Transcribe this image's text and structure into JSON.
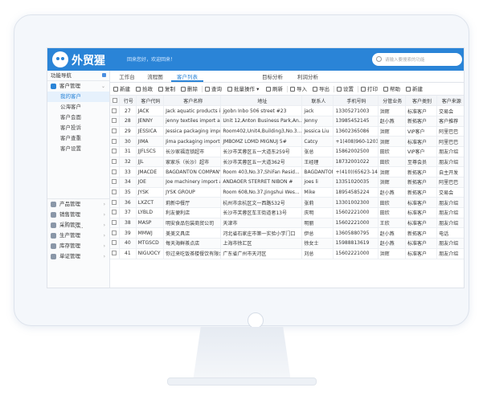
{
  "header": {
    "logo_text": "外贸猩",
    "welcome": "回来您好，欢迎回来！",
    "search_placeholder": "请输入要搜索的功能"
  },
  "sidebar": {
    "title": "功能导航",
    "group_open": "客户管理",
    "subitems": [
      "我的客户",
      "公海客户",
      "客户会面",
      "客户投诉",
      "客户查重",
      "客户设置"
    ],
    "groups": [
      "产品管理",
      "销售管理",
      "采购管理",
      "生产管理",
      "库存管理",
      "单证管理"
    ]
  },
  "tabs": [
    "工作台",
    "流程图",
    "客户列表",
    "目标分析",
    "利润分析"
  ],
  "toolbar": [
    "新建",
    "拾政",
    "复制",
    "删除",
    "查询",
    "批量操作",
    "刷新",
    "导入",
    "导出",
    "设置",
    "打印",
    "帮助",
    "新建"
  ],
  "table": {
    "headers": [
      "",
      "行号",
      "客户代码",
      "客户名称",
      "地址",
      "联系人",
      "手机号码",
      "分管业务",
      "客户类别",
      "客户来源",
      "客户"
    ],
    "rows": [
      [
        "27",
        "JACK",
        "Jack aquatic products im...",
        "jgobn  Inbo  506 street #23",
        "jack",
        "13305271003",
        "洪辉",
        "标准客户",
        "交易会",
        "B"
      ],
      [
        "28",
        "JENNY",
        "jenny textiles import and e...",
        "Unit 12,Anton Business Park,An...",
        "Jenny",
        "13985452145",
        "赵小燕",
        "新拓客户",
        "客户推荐",
        "C"
      ],
      [
        "29",
        "JESSICA",
        "Jessica packaging import...",
        "Room402,Unit4,Building3,No.3...",
        "Jessica Liu",
        "13602365086",
        "洪辉",
        "VIP客户",
        "阿里巴巴",
        "B"
      ],
      [
        "30",
        "JIMA",
        "Jima packaging import an...",
        "JMBOMZ  LOMD  MIGNUJ 5#",
        "Catcy",
        "+1(408)960-1203",
        "洪辉",
        "标准客户",
        "阿里巴巴",
        "C"
      ],
      [
        "31",
        "JJFLSCS",
        "长沙家福连锁超市",
        "长沙市芙蓉区五一大道东259号",
        "张总",
        "15862002500",
        "田欣",
        "VIP客户",
        "朋友介绍",
        "A"
      ],
      [
        "32",
        "JJL",
        "家家乐（长沙）超市",
        "长沙市芙蓉区五一大道362号",
        "王经理",
        "18732001022",
        "田欣",
        "至尊会员",
        "朋友介绍",
        "A"
      ],
      [
        "33",
        "JMACDE",
        "BAGDANTON  COMPANY",
        "Room 403,No.37,ShiFan Resid...",
        "BAGDANTON",
        "+(410)(65623-14711",
        "洪辉",
        "新拓客户",
        "自主开发",
        "A"
      ],
      [
        "34",
        "JOE",
        "Joe machinery import and...",
        "ANDAOER  STERRET NIBON  #",
        "joes li",
        "13351020035",
        "洪辉",
        "新拓客户",
        "阿里巴巴",
        "A"
      ],
      [
        "35",
        "JYSK",
        "JYSK GROUP",
        "Room 608,No.37,Jingshui Wes...",
        "Mike",
        "18954585224",
        "赵小燕",
        "新拓客户",
        "交易会",
        "A"
      ],
      [
        "36",
        "LXZCT",
        "莉新中餐厅",
        "杭州市余杭区文一西路532号",
        "张莉",
        "13301002300",
        "田欣",
        "标准客户",
        "朋友介绍",
        "B"
      ],
      [
        "37",
        "LYBLD",
        "利友便利店",
        "长沙市芙蓉区车王街道者13号",
        "庆明",
        "15602221000",
        "田欣",
        "标准客户",
        "朋友介绍",
        "A"
      ],
      [
        "38",
        "MASP",
        "明安食品包装商贸公司",
        "天津市",
        "明丽",
        "15602221000",
        "王欣",
        "标准客户",
        "朋友介绍",
        "A"
      ],
      [
        "39",
        "MMWJ",
        "美美文具店",
        "河北省石家庄市第一实验小学门口",
        "伊总",
        "13605880795",
        "赵小燕",
        "新拓客户",
        "电话",
        "B"
      ],
      [
        "40",
        "MTGSCD",
        "每天海鲜茶点店",
        "上海市徐汇区",
        "徐女士",
        "15988813619",
        "赵小燕",
        "标准客户",
        "朋友介绍",
        "A"
      ],
      [
        "41",
        "NIGUOCY",
        "你过来吃饭茶楼餐饮有限公司",
        "广东省广州市天河区",
        "刘总",
        "15602221000",
        "洪辉",
        "标准客户",
        "朋友介绍",
        "A"
      ]
    ]
  }
}
